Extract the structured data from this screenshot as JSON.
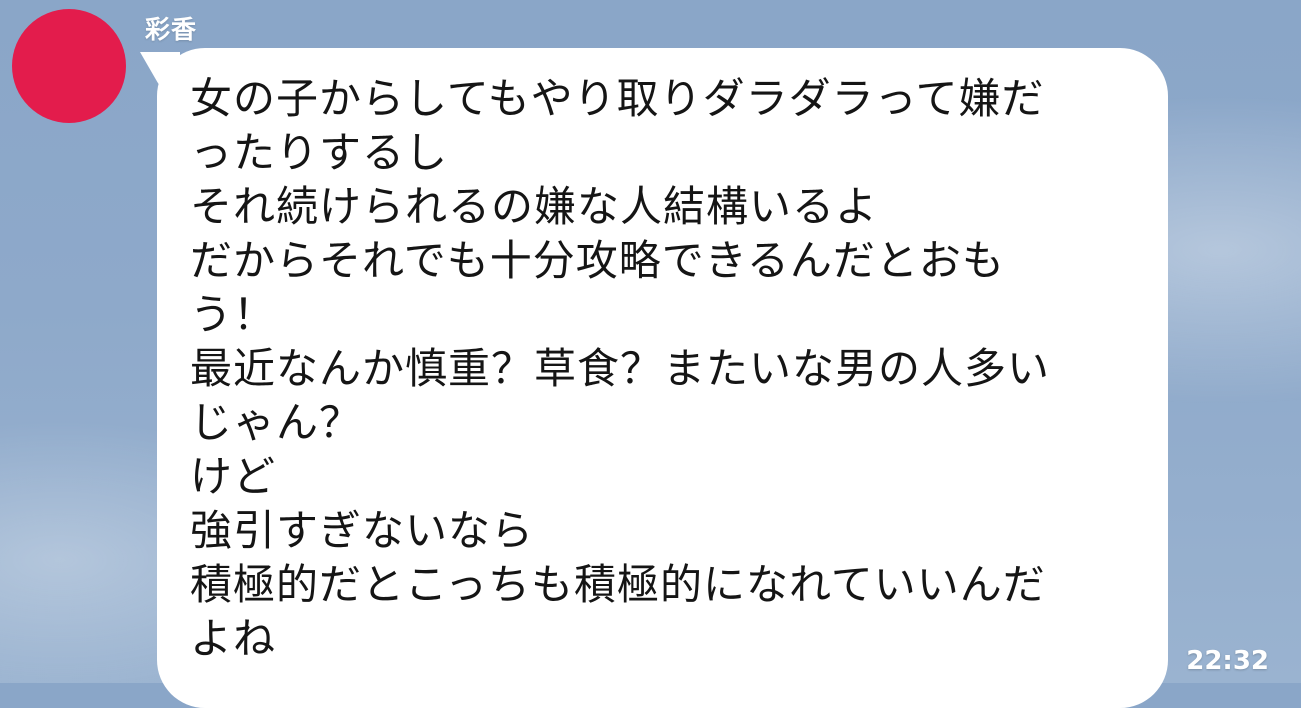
{
  "message": {
    "sender": "彩香",
    "avatar_color": "#e31c4c",
    "bubble_color": "#ffffff",
    "lines": [
      "女の子からしてもやり取りダラダラって嫌だ",
      "ったりするし",
      "それ続けられるの嫌な人結構いるよ",
      "だからそれでも十分攻略できるんだとおも",
      "う！",
      "最近なんか慎重？草食？またいな男の人多い",
      "じゃん？",
      "けど",
      "強引すぎないなら",
      "積極的だとこっちも積極的になれていいんだ",
      "よね"
    ],
    "time": "22:32"
  },
  "theme": {
    "background_color": "#8ea9ca"
  }
}
